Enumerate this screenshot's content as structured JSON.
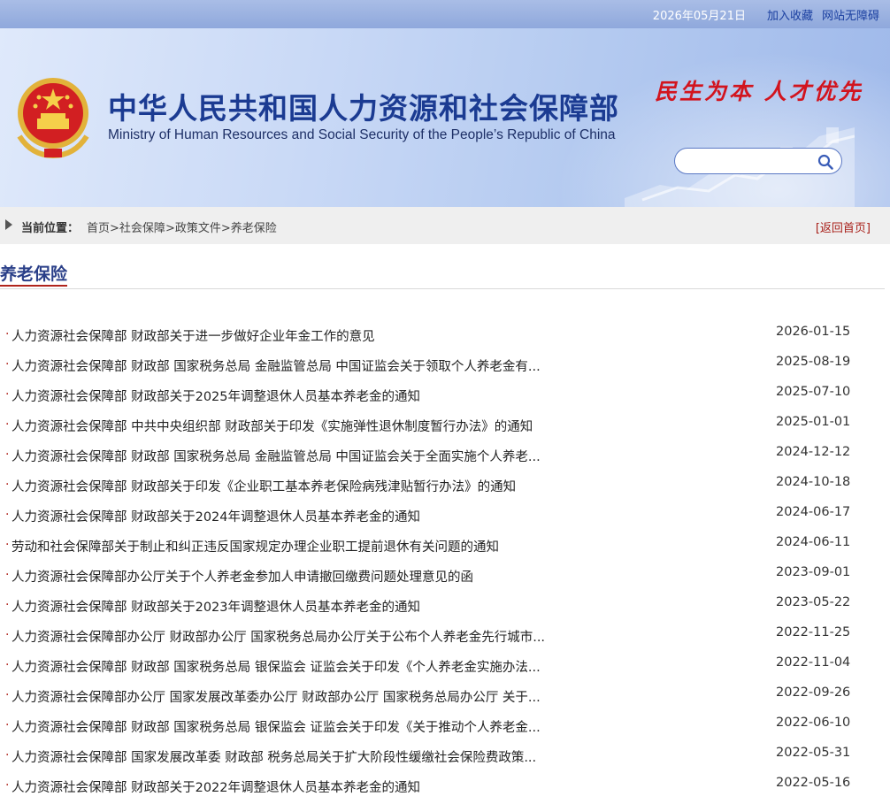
{
  "topbar": {
    "date": "2026年05月21日",
    "favorite": "加入收藏",
    "accessibility": "网站无障碍"
  },
  "header": {
    "title_cn": "中华人民共和国人力资源和社会保障部",
    "title_en": "Ministry of Human Resources and Social Security of the People’s Republic of China",
    "slogan": "民生为本 人才优先",
    "search_placeholder": ""
  },
  "breadcrumb": {
    "label": "当前位置：",
    "items": [
      "首页",
      "社会保障",
      "政策文件",
      "养老保险"
    ],
    "separator": ">",
    "back": "[返回首页]"
  },
  "section": {
    "title": "养老保险"
  },
  "articles": [
    {
      "title": "人力资源社会保障部 财政部关于进一步做好企业年金工作的意见",
      "date": "2026-01-15"
    },
    {
      "title": "人力资源社会保障部 财政部 国家税务总局 金融监管总局 中国证监会关于领取个人养老金有...",
      "date": "2025-08-19"
    },
    {
      "title": "人力资源社会保障部 财政部关于2025年调整退休人员基本养老金的通知",
      "date": "2025-07-10"
    },
    {
      "title": "人力资源社会保障部 中共中央组织部 财政部关于印发《实施弹性退休制度暂行办法》的通知",
      "date": "2025-01-01"
    },
    {
      "title": "人力资源社会保障部 财政部 国家税务总局 金融监管总局 中国证监会关于全面实施个人养老...",
      "date": "2024-12-12"
    },
    {
      "title": "人力资源社会保障部 财政部关于印发《企业职工基本养老保险病残津贴暂行办法》的通知",
      "date": "2024-10-18"
    },
    {
      "title": "人力资源社会保障部 财政部关于2024年调整退休人员基本养老金的通知",
      "date": "2024-06-17"
    },
    {
      "title": "劳动和社会保障部关于制止和纠正违反国家规定办理企业职工提前退休有关问题的通知",
      "date": "2024-06-11"
    },
    {
      "title": "人力资源社会保障部办公厅关于个人养老金参加人申请撤回缴费问题处理意见的函",
      "date": "2023-09-01"
    },
    {
      "title": "人力资源社会保障部 财政部关于2023年调整退休人员基本养老金的通知",
      "date": "2023-05-22"
    },
    {
      "title": "人力资源社会保障部办公厅 财政部办公厅 国家税务总局办公厅关于公布个人养老金先行城市...",
      "date": "2022-11-25"
    },
    {
      "title": "人力资源社会保障部 财政部 国家税务总局 银保监会 证监会关于印发《个人养老金实施办法...",
      "date": "2022-11-04"
    },
    {
      "title": "人力资源社会保障部办公厅 国家发展改革委办公厅 财政部办公厅 国家税务总局办公厅 关于...",
      "date": "2022-09-26"
    },
    {
      "title": "人力资源社会保障部 财政部 国家税务总局 银保监会 证监会关于印发《关于推动个人养老金...",
      "date": "2022-06-10"
    },
    {
      "title": "人力资源社会保障部 国家发展改革委 财政部 税务总局关于扩大阶段性缓缴社会保险费政策...",
      "date": "2022-05-31"
    },
    {
      "title": "人力资源社会保障部 财政部关于2022年调整退休人员基本养老金的通知",
      "date": "2022-05-16"
    }
  ],
  "colors": {
    "accent_blue": "#1b3b92",
    "accent_red": "#b0241c",
    "topbar_link": "#1a3fa0"
  },
  "icons": {
    "emblem": "national-emblem-icon",
    "search": "search-icon",
    "breadcrumb_marker": "triangle-right-icon"
  }
}
